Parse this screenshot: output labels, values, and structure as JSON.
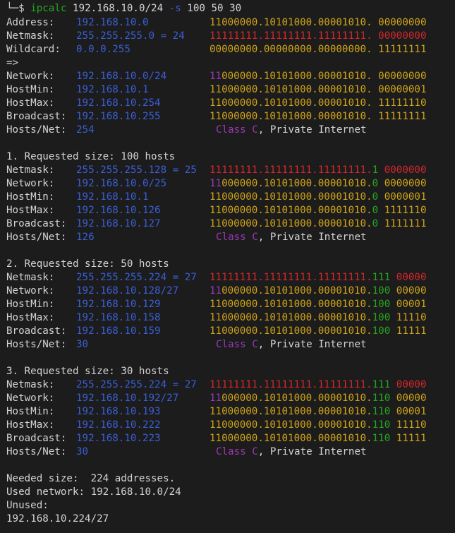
{
  "prompt": {
    "corner": "└─",
    "symbol": "$",
    "command": "ipcalc",
    "args": "192.168.10.0/24",
    "flag": "-s",
    "sizes": "100 50 30"
  },
  "main": {
    "address": {
      "label": "Address:",
      "ip": "192.168.10.0",
      "bin": "11000000.10101000.00001010. 00000000"
    },
    "netmask": {
      "label": "Netmask:",
      "ip": "255.255.255.0 = 24",
      "bin1": "11111111.11111111.11111111.",
      "bin2": " 00000000"
    },
    "wildcard": {
      "label": "Wildcard:",
      "ip": "0.0.0.255",
      "bin": "00000000.00000000.00000000. 11111111"
    },
    "arrow": "=>",
    "network": {
      "label": "Network:",
      "ip": "192.168.10.0/24",
      "cls": "11",
      "bin": "000000.10101000.00001010. 00000000"
    },
    "hostmin": {
      "label": "HostMin:",
      "ip": "192.168.10.1",
      "bin": "11000000.10101000.00001010. 00000001"
    },
    "hostmax": {
      "label": "HostMax:",
      "ip": "192.168.10.254",
      "bin": "11000000.10101000.00001010. 11111110"
    },
    "broadcast": {
      "label": "Broadcast:",
      "ip": "192.168.10.255",
      "bin": "11000000.10101000.00001010. 11111111"
    },
    "hosts": {
      "label": "Hosts/Net:",
      "count": "254",
      "class_label": "Class C",
      "private": ", Private Internet"
    }
  },
  "subnets": [
    {
      "header": "1. Requested size: 100 hosts",
      "netmask": {
        "label": "Netmask:",
        "ip": "255.255.255.128 = 25",
        "bin1": "11111111.11111111.11111111.",
        "sub": "1",
        "bin2": " 0000000"
      },
      "network": {
        "label": "Network:",
        "ip": "192.168.10.0/25",
        "cls": "11",
        "bin": "000000.10101000.00001010.",
        "sub": "0",
        "host": " 0000000"
      },
      "hostmin": {
        "label": "HostMin:",
        "ip": "192.168.10.1",
        "bin": "11000000.10101000.00001010.",
        "sub": "0",
        "host": " 0000001"
      },
      "hostmax": {
        "label": "HostMax:",
        "ip": "192.168.10.126",
        "bin": "11000000.10101000.00001010.",
        "sub": "0",
        "host": " 1111110"
      },
      "broadcast": {
        "label": "Broadcast:",
        "ip": "192.168.10.127",
        "bin": "11000000.10101000.00001010.",
        "sub": "0",
        "host": " 1111111"
      },
      "hosts": {
        "label": "Hosts/Net:",
        "count": "126",
        "class_label": "Class C",
        "private": ", Private Internet"
      }
    },
    {
      "header": "2. Requested size: 50 hosts",
      "netmask": {
        "label": "Netmask:",
        "ip": "255.255.255.224 = 27",
        "bin1": "11111111.11111111.11111111.",
        "sub": "111",
        "bin2": " 00000"
      },
      "network": {
        "label": "Network:",
        "ip": "192.168.10.128/27",
        "cls": "11",
        "bin": "000000.10101000.00001010.",
        "sub": "100",
        "host": " 00000"
      },
      "hostmin": {
        "label": "HostMin:",
        "ip": "192.168.10.129",
        "bin": "11000000.10101000.00001010.",
        "sub": "100",
        "host": " 00001"
      },
      "hostmax": {
        "label": "HostMax:",
        "ip": "192.168.10.158",
        "bin": "11000000.10101000.00001010.",
        "sub": "100",
        "host": " 11110"
      },
      "broadcast": {
        "label": "Broadcast:",
        "ip": "192.168.10.159",
        "bin": "11000000.10101000.00001010.",
        "sub": "100",
        "host": " 11111"
      },
      "hosts": {
        "label": "Hosts/Net:",
        "count": "30",
        "class_label": "Class C",
        "private": ", Private Internet"
      }
    },
    {
      "header": "3. Requested size: 30 hosts",
      "netmask": {
        "label": "Netmask:",
        "ip": "255.255.255.224 = 27",
        "bin1": "11111111.11111111.11111111.",
        "sub": "111",
        "bin2": " 00000"
      },
      "network": {
        "label": "Network:",
        "ip": "192.168.10.192/27",
        "cls": "11",
        "bin": "000000.10101000.00001010.",
        "sub": "110",
        "host": " 00000"
      },
      "hostmin": {
        "label": "HostMin:",
        "ip": "192.168.10.193",
        "bin": "11000000.10101000.00001010.",
        "sub": "110",
        "host": " 00001"
      },
      "hostmax": {
        "label": "HostMax:",
        "ip": "192.168.10.222",
        "bin": "11000000.10101000.00001010.",
        "sub": "110",
        "host": " 11110"
      },
      "broadcast": {
        "label": "Broadcast:",
        "ip": "192.168.10.223",
        "bin": "11000000.10101000.00001010.",
        "sub": "110",
        "host": " 11111"
      },
      "hosts": {
        "label": "Hosts/Net:",
        "count": "30",
        "class_label": "Class C",
        "private": ", Private Internet"
      }
    }
  ],
  "summary": {
    "needed": "Needed size:  224 addresses.",
    "used": "Used network: 192.168.10.0/24",
    "unused_label": "Unused:",
    "unused_net": "192.168.10.224/27"
  }
}
